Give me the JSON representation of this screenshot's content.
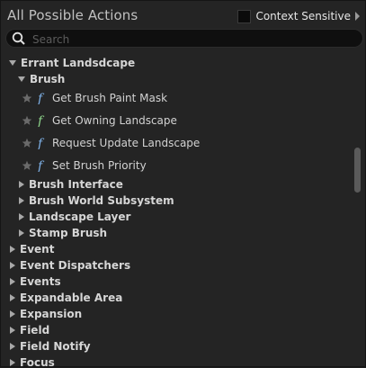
{
  "header": {
    "title": "All Possible Actions",
    "context_sensitive_label": "Context Sensitive"
  },
  "search": {
    "placeholder": "Search",
    "value": ""
  },
  "tree": {
    "category": "Errant Landsdcape",
    "subcategory": "Brush",
    "actions": [
      {
        "label": "Get Brush Paint Mask",
        "icon_color": "#7fb2e8"
      },
      {
        "label": "Get Owning Landscape",
        "icon_color": "#8ed58b"
      },
      {
        "label": "Request Update Landscape",
        "icon_color": "#7fb2e8"
      },
      {
        "label": "Set Brush Priority",
        "icon_color": "#7fb2e8"
      }
    ],
    "sub_groups": [
      "Brush Interface",
      "Brush World Subsystem",
      "Landscape Layer",
      "Stamp Brush"
    ],
    "top_groups": [
      "Event",
      "Event Dispatchers",
      "Events",
      "Expandable Area",
      "Expansion",
      "Field",
      "Field Notify",
      "Focus"
    ]
  },
  "colors": {
    "panel_bg": "#242424",
    "text": "#d6d6d6",
    "function_blue": "#7fb2e8",
    "function_green": "#8ed58b"
  }
}
